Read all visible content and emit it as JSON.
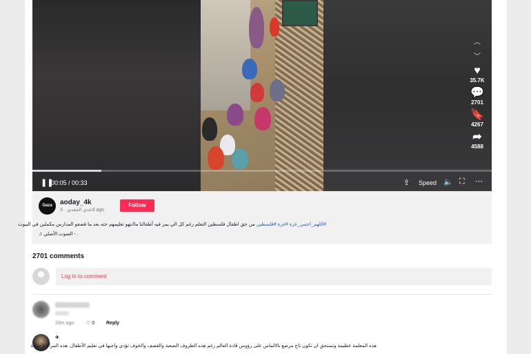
{
  "player": {
    "time": "00:05 / 00:33",
    "progress": 0.15,
    "speed_label": "Speed",
    "icons": [
      "play-pause-icon",
      "sync-icon",
      "volume-icon",
      "fullscreen-icon",
      "more-icon"
    ]
  },
  "side_actions": {
    "likes": "35.7K",
    "comments": "2701",
    "saves": "4267",
    "shares": "4588"
  },
  "post": {
    "avatar_text": "Gaza",
    "username": "aoday_4k",
    "meta": "عدي الجعدي · 3d ago",
    "follow_label": "Follow",
    "caption_tags": "#اللهم_احمي_غزة #غزة #فلسطين",
    "caption_text": "من حق اطفال فلسطين التعلم رغم كل الي يمر فيه أطفالنا ماانتهو تعليمهم حته بعد ما قصفو المدارس مكملين في البيوت",
    "sound": "الصوت الأصلي - ."
  },
  "comments_section": {
    "count_label": "2701 comments",
    "login_label": "Log in to comment",
    "comments": [
      {
        "time": "33m ago",
        "likes": "0",
        "reply_label": "Reply"
      },
      {
        "name": "✈",
        "text": "هذه المعلمة عظيمة وتستحق ان تكون تاج مرصع بالالماس على رؤوس قادة العالم رغم هذه الظروف الصعبة والقصف والخوف تؤدي واجبها في تعليم الأطفال. هذه المرأة يا سادة"
      }
    ]
  }
}
